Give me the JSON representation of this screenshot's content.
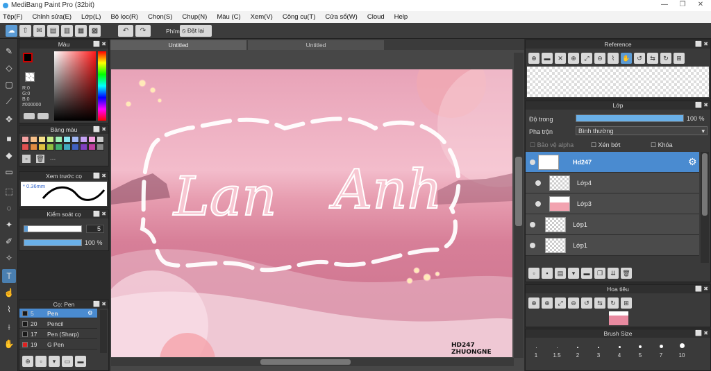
{
  "window": {
    "title": "MediBang Paint Pro (32bit)",
    "controls": [
      "—",
      "❐",
      "✕"
    ]
  },
  "menu": [
    "Tệp(F)",
    "Chỉnh sửa(E)",
    "Lớp(L)",
    "Bộ lọc(R)",
    "Chọn(S)",
    "Chụp(N)",
    "Màu (C)",
    "Xem(V)",
    "Công cụ(T)",
    "Cửa sổ(W)",
    "Cloud",
    "Help"
  ],
  "toolbar": {
    "shortcut_label": "Phím",
    "reset_label": "Đặt lại"
  },
  "tabs": [
    "Untitled",
    "Untitled"
  ],
  "color_panel": {
    "title": "Màu",
    "r": "R:0",
    "g": "G:0",
    "b": "B:0",
    "hex": "#000000",
    "primary": "#000000",
    "hue_base": "#ff1a1a"
  },
  "palette_panel": {
    "title": "Bảng màu",
    "colors": [
      "#f5a3a3",
      "#f7c08a",
      "#f7e08a",
      "#c9ef8a",
      "#9ef0b6",
      "#8ae6f0",
      "#a3b8f5",
      "#c6a3f5",
      "#f5a3e0",
      "#cccccc",
      "#e05050",
      "#e08a40",
      "#e0c040",
      "#90c040",
      "#40b070",
      "#40a8c0",
      "#4060c0",
      "#8040c0",
      "#c040a0",
      "#888888"
    ],
    "extra": "---"
  },
  "brush_preview": {
    "title": "Xem trước cọ",
    "size": "0.36mm"
  },
  "brush_control": {
    "title": "Kiểm soát cọ",
    "size": "5",
    "opacity": "100 %",
    "opacity_fraction": 1.0
  },
  "brush_list": {
    "title": "Cọ: Pen",
    "items": [
      {
        "num": "5",
        "name": "Pen",
        "color": "#1a1a1a",
        "selected": true
      },
      {
        "num": "20",
        "name": "Pencil",
        "color": "#1a1a1a"
      },
      {
        "num": "17",
        "name": "Pen (Sharp)",
        "color": "#1a1a1a"
      },
      {
        "num": "19",
        "name": "G Pen",
        "color": "#e02020"
      }
    ]
  },
  "artwork": {
    "text_left": "Lan",
    "text_right": "Anh",
    "signature_line1": "HD247",
    "signature_line2": "ZHUONGNE"
  },
  "reference_panel": {
    "title": "Reference"
  },
  "layer_panel": {
    "title": "Lớp",
    "opacity_label": "Độ trong",
    "opacity_value": "100 %",
    "opacity_fraction": 1.0,
    "blend_label": "Pha trộn",
    "blend_value": "Bình thường",
    "protect_alpha": "Bảo vệ alpha",
    "clipping": "Xén bớt",
    "lock": "Khóa",
    "layers": [
      {
        "name": "Hd247",
        "selected": true,
        "indent": false
      },
      {
        "name": "Lớp4",
        "selected": false,
        "indent": true
      },
      {
        "name": "Lớp3",
        "selected": false,
        "indent": true
      },
      {
        "name": "Lớp1",
        "selected": false,
        "indent": false
      },
      {
        "name": "Lớp1",
        "selected": false,
        "indent": false
      }
    ]
  },
  "navigator_panel": {
    "title": "Hoa tiêu"
  },
  "brush_size_panel": {
    "title": "Brush Size",
    "sizes": [
      "1",
      "1.5",
      "2",
      "3",
      "4",
      "5",
      "7",
      "10"
    ]
  }
}
